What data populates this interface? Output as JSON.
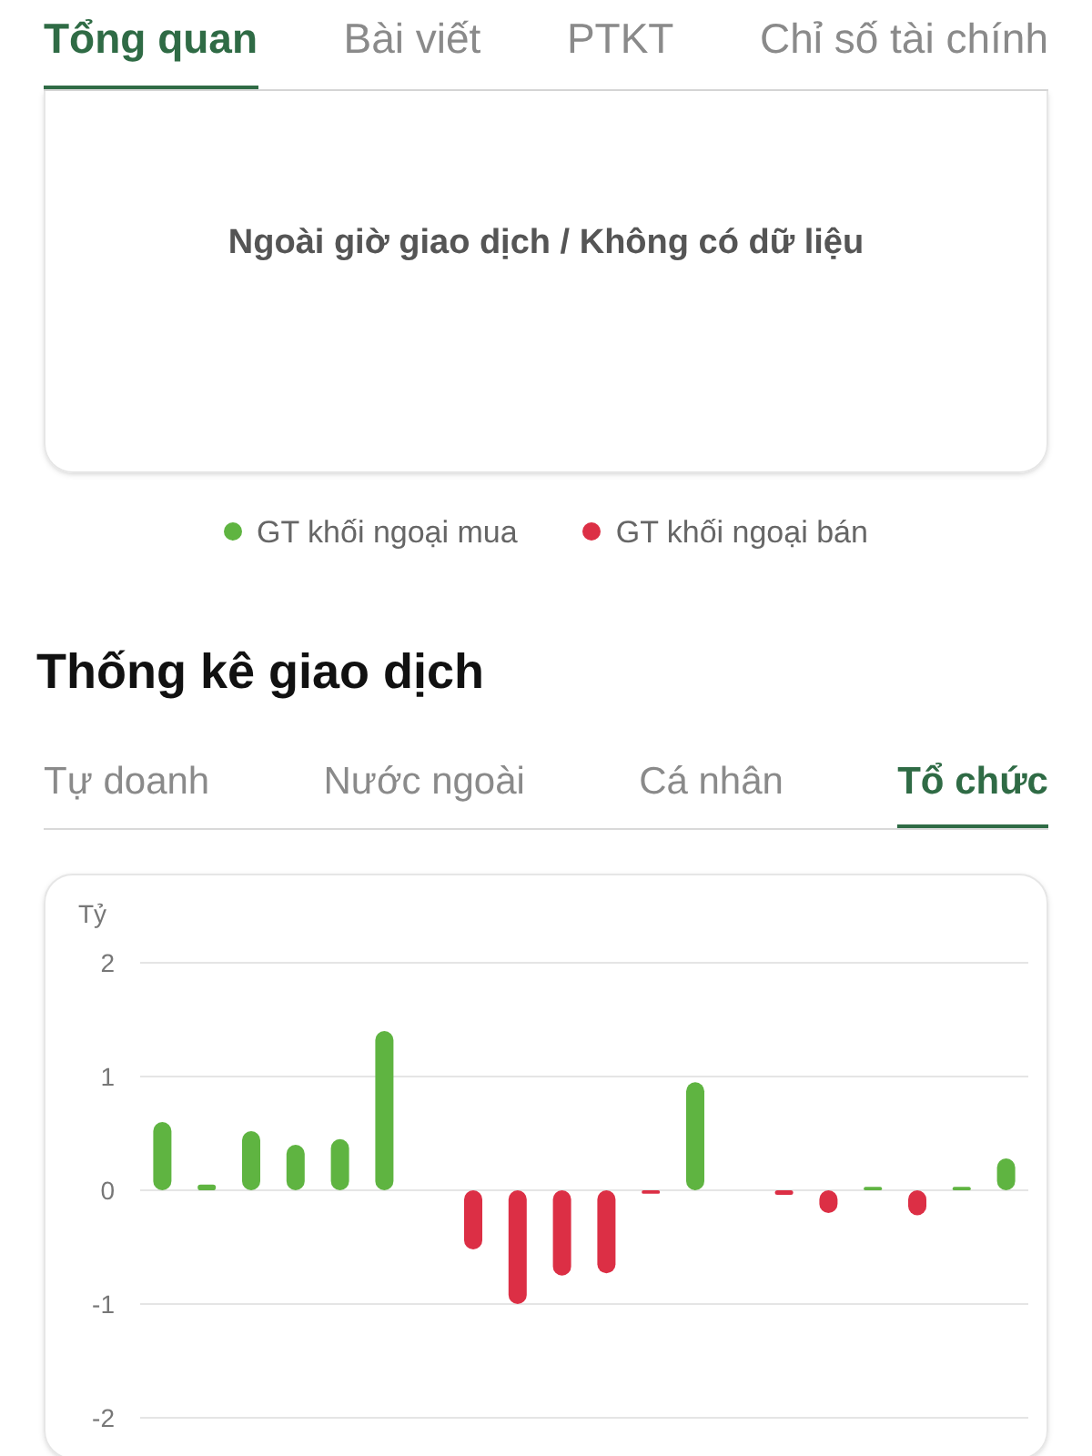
{
  "top_tabs": [
    {
      "label": "Tổng quan",
      "selected": true
    },
    {
      "label": "Bài viết",
      "selected": false
    },
    {
      "label": "PTKT",
      "selected": false
    },
    {
      "label": "Chỉ số tài chính",
      "selected": false
    }
  ],
  "foreign_card": {
    "message": "Ngoài giờ giao dịch / Không có dữ liệu"
  },
  "legend": [
    {
      "label": "GT khối ngoại mua",
      "color": "#5fb441"
    },
    {
      "label": "GT khối ngoại bán",
      "color": "#dc2f45"
    }
  ],
  "section_title": "Thống kê giao dịch",
  "stat_tabs": [
    {
      "label": "Tự doanh",
      "selected": false
    },
    {
      "label": "Nước ngoài",
      "selected": false
    },
    {
      "label": "Cá nhân",
      "selected": false
    },
    {
      "label": "Tổ chức",
      "selected": true
    }
  ],
  "stat_chart": {
    "chart_data": {
      "type": "bar",
      "ylabel": "Tỷ",
      "ylim": [
        -2,
        2
      ],
      "yticks": [
        2,
        1,
        0,
        -1,
        -2
      ],
      "grid": true,
      "series": [
        {
          "color": "#5fb441",
          "values": [
            0.6,
            0.05,
            0.52,
            0.4,
            0.45,
            1.4,
            null,
            null,
            null,
            null,
            null,
            null,
            0.95,
            null,
            null,
            null,
            0.03,
            null,
            0.03,
            0.28
          ]
        },
        {
          "color": "#dc2f45",
          "values": [
            null,
            null,
            null,
            null,
            null,
            null,
            null,
            -0.52,
            -1.0,
            -0.75,
            -0.73,
            -0.03,
            null,
            null,
            -0.04,
            -0.2,
            null,
            -0.22,
            null,
            null
          ]
        }
      ]
    }
  }
}
